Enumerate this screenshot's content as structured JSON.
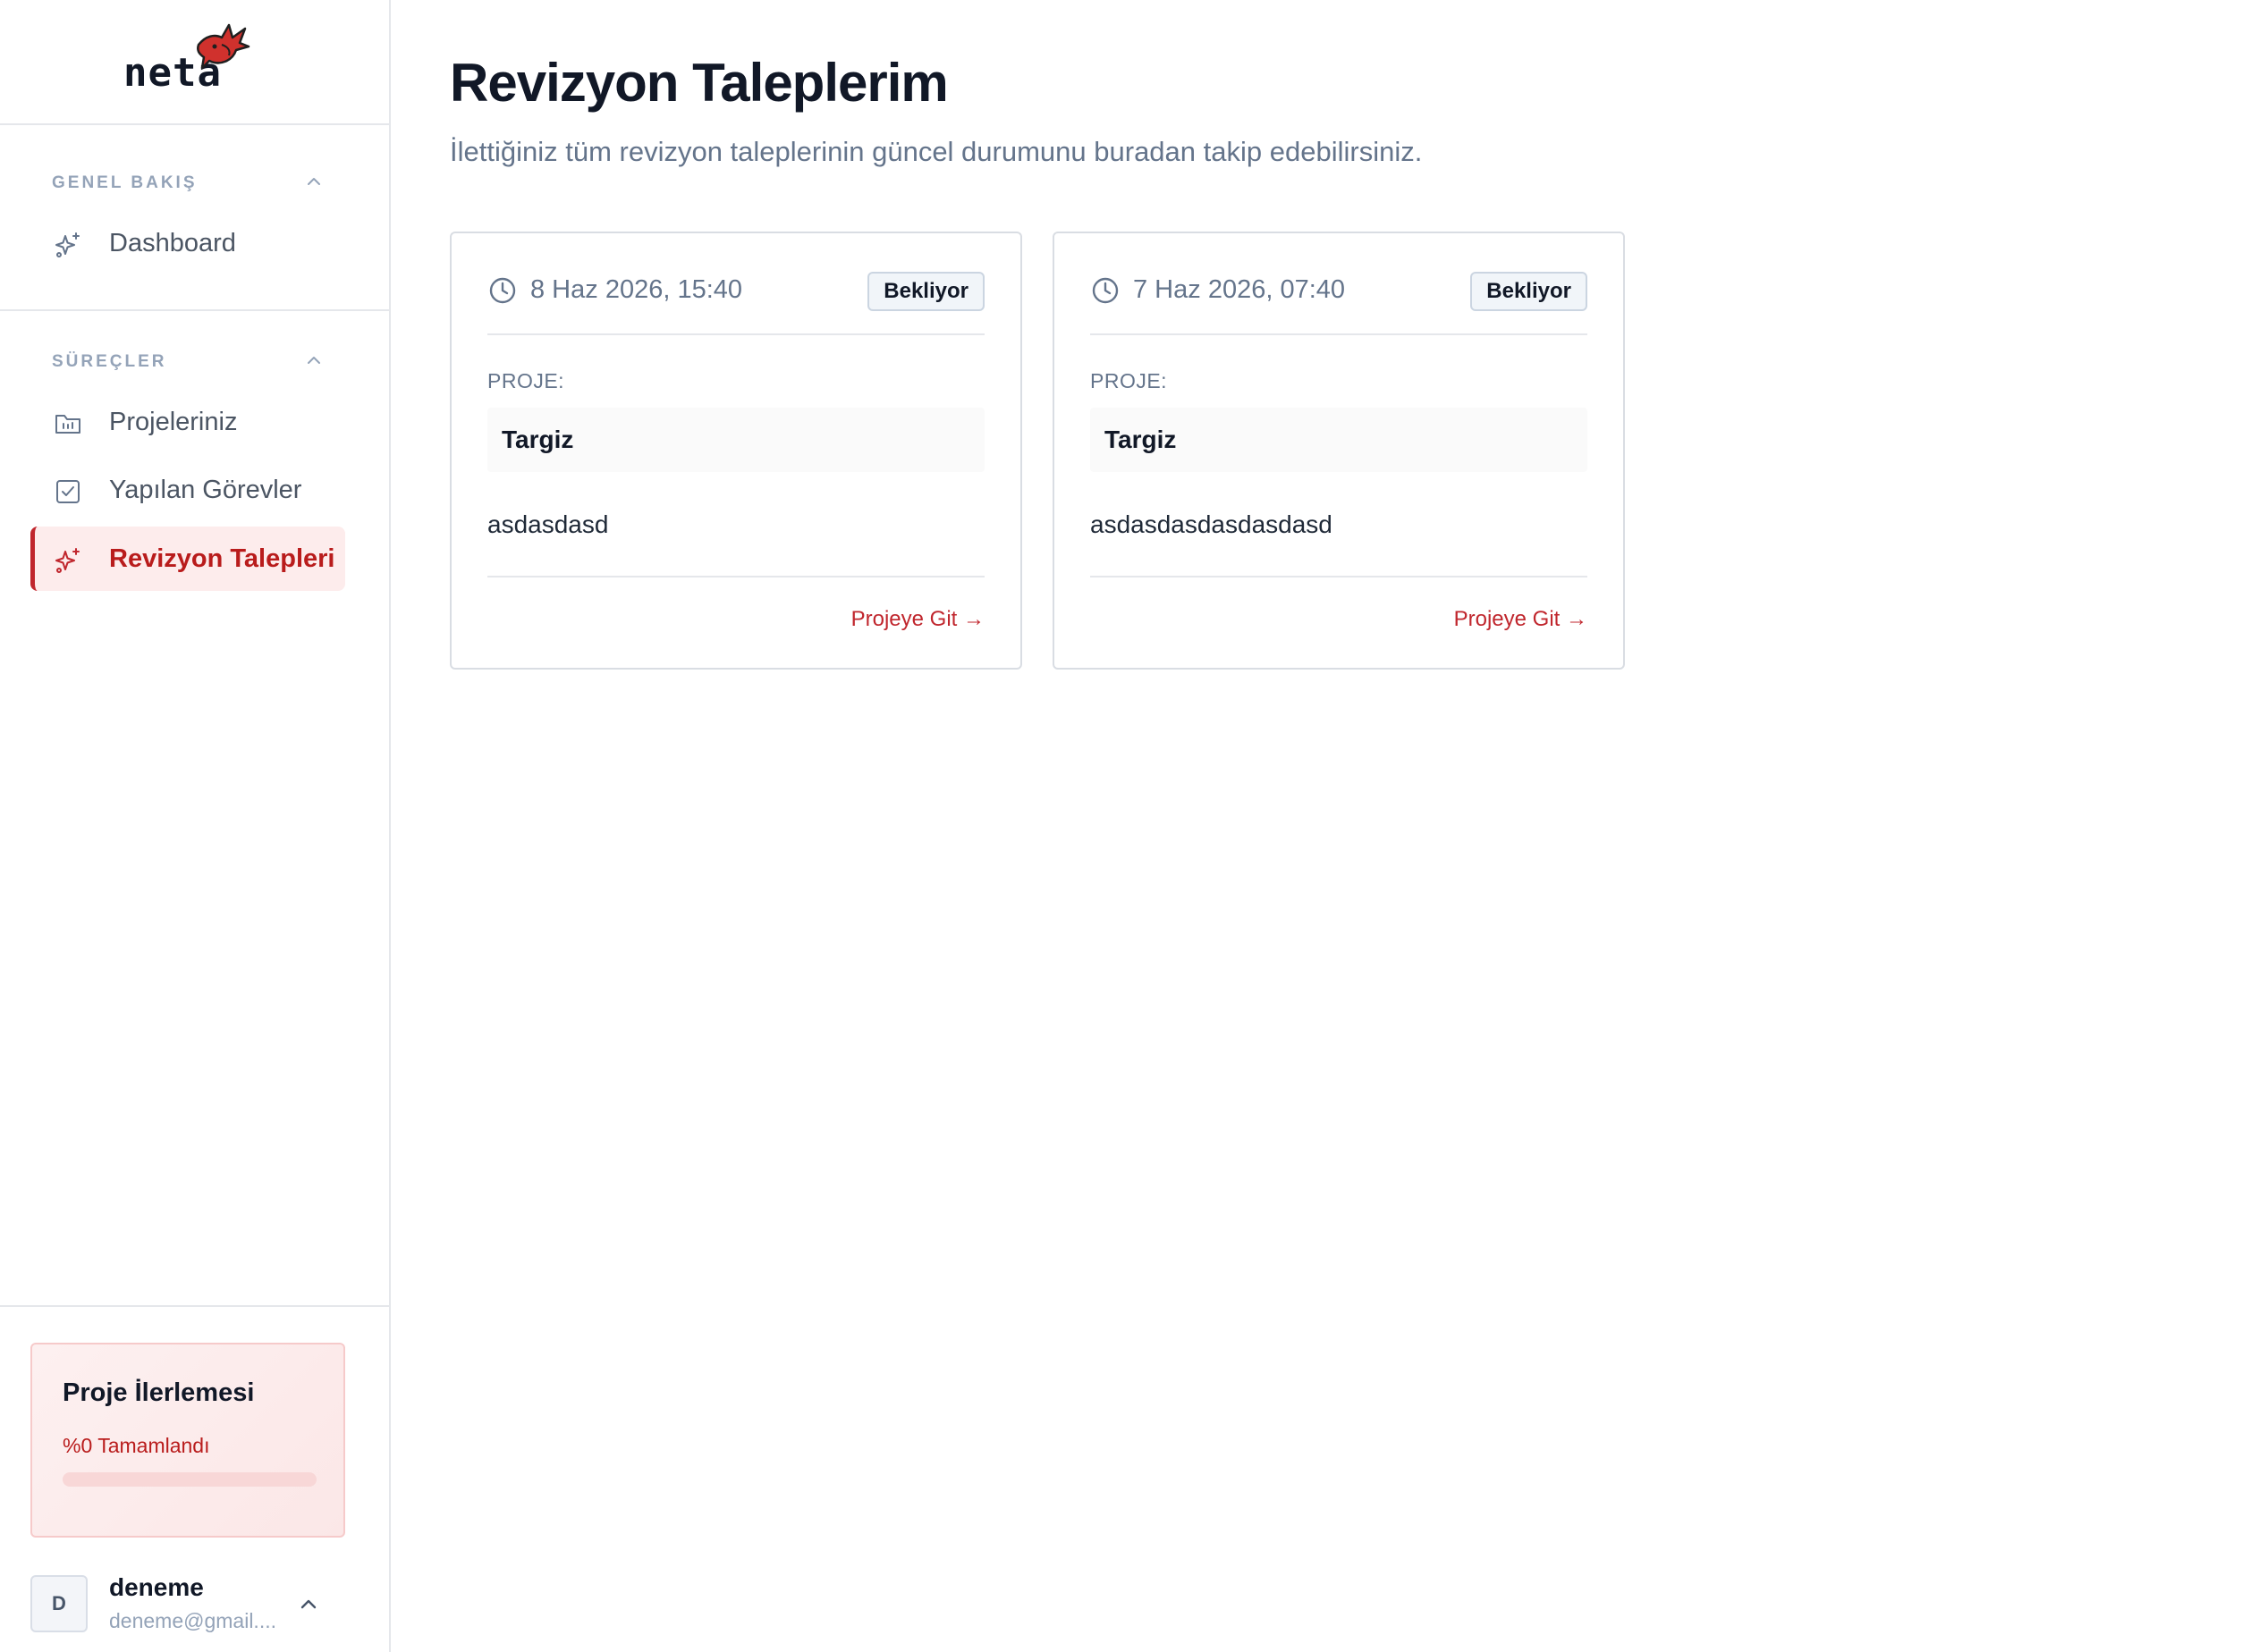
{
  "brand": {
    "logo_text": "neta",
    "accent": "#c0262d"
  },
  "sidebar": {
    "sections": [
      {
        "title": "GENEL BAKIŞ",
        "items": [
          {
            "label": "Dashboard",
            "icon": "sparkles-icon",
            "active": false
          }
        ]
      },
      {
        "title": "SÜREÇLER",
        "items": [
          {
            "label": "Projeleriniz",
            "icon": "folder-icon",
            "active": false
          },
          {
            "label": "Yapılan Görevler",
            "icon": "checkbox-icon",
            "active": false
          },
          {
            "label": "Revizyon Talepleri",
            "icon": "sparkles-icon",
            "active": true
          }
        ]
      }
    ],
    "progress": {
      "title": "Proje İlerlemesi",
      "status": "%0 Tamamlandı",
      "percent": 0
    },
    "user": {
      "avatar_letter": "D",
      "name": "deneme",
      "email": "deneme@gmail...."
    }
  },
  "main": {
    "title": "Revizyon Taleplerim",
    "subtitle": "İlettiğiniz tüm revizyon taleplerinin güncel durumunu buradan takip edebilirsiniz.",
    "cards": [
      {
        "date": "8 Haz 2026, 15:40",
        "status": "Bekliyor",
        "project_label": "PROJE:",
        "project_name": "Targiz",
        "note": "asdasdasd",
        "link": "Projeye Git →"
      },
      {
        "date": "7 Haz 2026, 07:40",
        "status": "Bekliyor",
        "project_label": "PROJE:",
        "project_name": "Targiz",
        "note": "asdasdasdasdasdasd",
        "link": "Projeye Git →"
      }
    ]
  }
}
